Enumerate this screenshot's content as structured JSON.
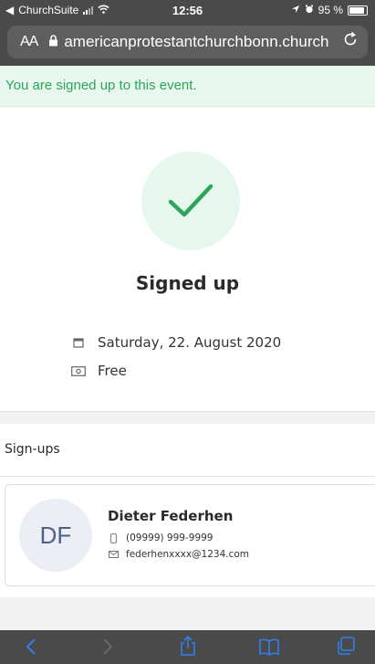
{
  "status_bar": {
    "back_app": "ChurchSuite",
    "time": "12:56",
    "battery": "95 %"
  },
  "browser": {
    "aa_label": "AA",
    "url": "americanprotestantchurchbonn.church",
    "reload_icon": "reload-icon"
  },
  "alert": {
    "message": "You are signed up to this event."
  },
  "confirmation": {
    "title": "Signed up",
    "date": "Saturday, 22. August 2020",
    "price": "Free",
    "accent_color": "#2aa55a"
  },
  "signups": {
    "heading": "Sign-ups",
    "people": [
      {
        "initials": "DF",
        "name": "Dieter Federhen",
        "phone": "(09999) 999-9999",
        "email": "federhenxxxx@1234.com"
      }
    ]
  },
  "toolbar": {
    "icons": [
      "back-icon",
      "forward-icon",
      "share-icon",
      "bookmarks-icon",
      "tabs-icon"
    ]
  }
}
